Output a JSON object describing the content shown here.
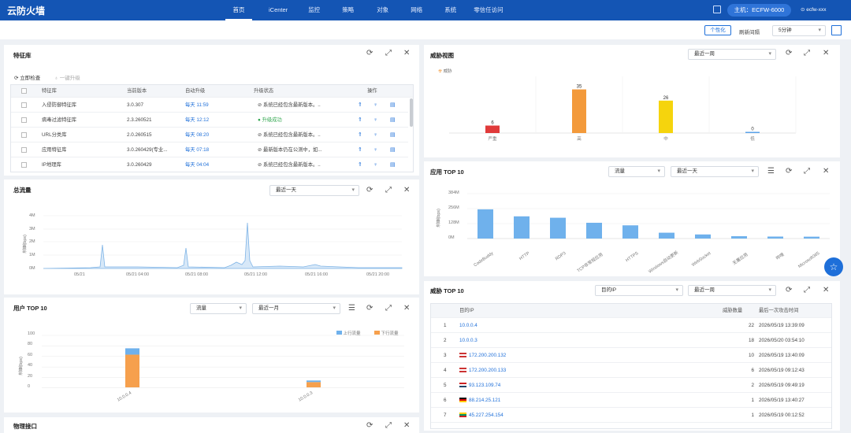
{
  "header": {
    "brand": "云防火墙",
    "nav": [
      "首页",
      "iCenter",
      "监控",
      "策略",
      "对象",
      "网络",
      "系统",
      "零信任访问"
    ],
    "host": "主机：ECFW-6000",
    "user": "ecfw-xxx"
  },
  "toolbar": {
    "personalize": "个性化",
    "refresh_label": "刷新间隔",
    "refresh_value": "5分钟"
  },
  "sig": {
    "title": "特征库",
    "check": "立即检查",
    "upgrade": "一键升级",
    "headers": [
      "特征库",
      "当前版本",
      "自动升级",
      "升级状态",
      "操作"
    ],
    "rows": [
      {
        "name": "入侵防御特征库",
        "ver": "3.0.307",
        "auto": "每天 11:59",
        "status": "系统已经包含最新版本。..",
        "ok": false
      },
      {
        "name": "病毒过滤特征库",
        "ver": "2.3.260521",
        "auto": "每天 12:12",
        "status": "升级成功",
        "ok": true
      },
      {
        "name": "URL分类库",
        "ver": "2.0.260515",
        "auto": "每天 08:20",
        "status": "系统已经包含最新版本。..",
        "ok": false
      },
      {
        "name": "应用特征库",
        "ver": "3.0.260429(专业...",
        "auto": "每天 07:18",
        "status": "最新版本仍在公测中，如...",
        "ok": false
      },
      {
        "name": "IP地理库",
        "ver": "3.0.260429",
        "auto": "每天 04:04",
        "status": "系统已经包含最新版本。..",
        "ok": false
      }
    ]
  },
  "traffic": {
    "title": "总流量",
    "range": "最近一天",
    "ylabel": "流量(bps)",
    "yticks": [
      "4M",
      "3M",
      "2M",
      "1M",
      "0M"
    ],
    "xticks": [
      "05/21",
      "05/21 04:00",
      "05/21 08:00",
      "05/21 12:00",
      "05/21 16:00",
      "05/21 20:00"
    ]
  },
  "users": {
    "title": "用户 TOP 10",
    "metric": "流量",
    "range": "最近一月",
    "legend": [
      "上行流量",
      "下行流量"
    ],
    "ylabel": "流量(bps)",
    "yticks": [
      "100",
      "80",
      "60",
      "40",
      "20",
      "0"
    ],
    "chart_data": {
      "type": "bar",
      "categories": [
        "10.0.0.4",
        "10.0.0.3"
      ],
      "series": [
        {
          "name": "上行流量",
          "values": [
            12,
            3
          ]
        },
        {
          "name": "下行流量",
          "values": [
            62,
            10
          ]
        }
      ],
      "ylim": [
        0,
        100
      ]
    }
  },
  "ports": {
    "title": "物理接口"
  },
  "threat": {
    "title": "威胁视图",
    "range": "最近一周",
    "legend": "威胁",
    "chart_data": {
      "type": "bar",
      "categories": [
        "严重",
        "高",
        "中",
        "低"
      ],
      "values": [
        6,
        35,
        26,
        0
      ],
      "colors": [
        "#e03a3a",
        "#f39a3b",
        "#f5d40d",
        "#5aa2e8"
      ],
      "ylim": [
        0,
        40
      ]
    }
  },
  "apps": {
    "title": "应用 TOP 10",
    "metric": "流量",
    "range": "最近一天",
    "ylabel": "流量(bps)",
    "yticks": [
      "384M",
      "256M",
      "128M",
      "0M"
    ],
    "chart_data": {
      "type": "bar",
      "categories": [
        "CodeBuddy",
        "HTTP",
        "RDP3",
        "TCP非常规应用",
        "HTTPS",
        "Windows自动更新",
        "WebSocket",
        "无署应用",
        "哔哩",
        "Microsoft365"
      ],
      "values": [
        250,
        190,
        178,
        135,
        113,
        50,
        35,
        20,
        17,
        16
      ],
      "ylim": [
        0,
        384
      ],
      "ylabel": "流量(bps)"
    }
  },
  "threats10": {
    "title": "威胁 TOP 10",
    "metric": "目的IP",
    "range": "最近一周",
    "headers": [
      "目的IP",
      "威胁数量",
      "最后一次攻击时间"
    ],
    "rows": [
      {
        "n": "1",
        "ip": "10.0.0.4",
        "flag": "",
        "count": "22",
        "time": "2026/05/19 13:39:09"
      },
      {
        "n": "2",
        "ip": "10.0.0.3",
        "flag": "",
        "count": "18",
        "time": "2026/05/20 03:54:10"
      },
      {
        "n": "3",
        "ip": "172.200.200.132",
        "flag": "us",
        "count": "10",
        "time": "2026/05/19 13:40:09"
      },
      {
        "n": "4",
        "ip": "172.200.200.133",
        "flag": "us",
        "count": "6",
        "time": "2026/05/19 09:12:43"
      },
      {
        "n": "5",
        "ip": "93.123.109.74",
        "flag": "nl",
        "count": "2",
        "time": "2026/05/19 09:49:19"
      },
      {
        "n": "6",
        "ip": "88.214.25.121",
        "flag": "de",
        "count": "1",
        "time": "2026/05/19 13:40:27"
      },
      {
        "n": "7",
        "ip": "45.227.254.154",
        "flag": "lt",
        "count": "1",
        "time": "2026/05/19 00:12:52"
      }
    ]
  }
}
